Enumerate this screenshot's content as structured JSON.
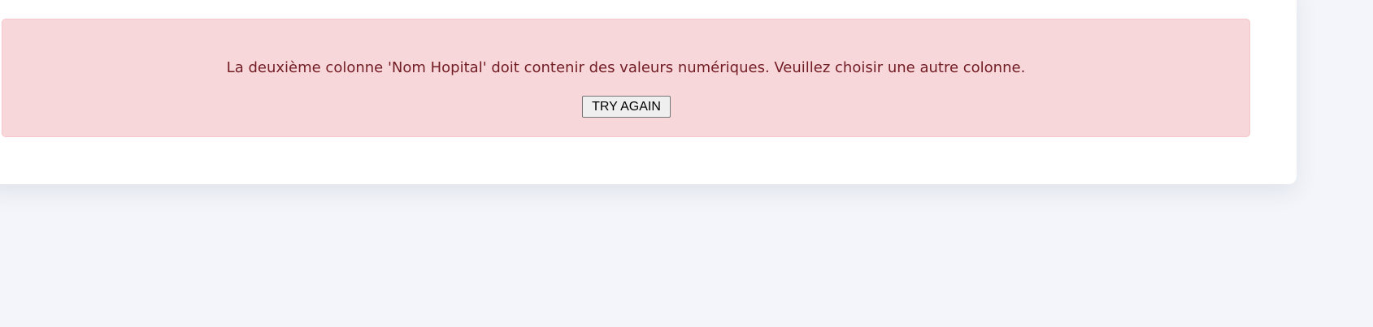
{
  "error_alert": {
    "message": "La deuxième colonne 'Nom Hopital' doit contenir des valeurs numériques. Veuillez choisir une autre colonne.",
    "try_again_label": "TRY AGAIN"
  },
  "colors": {
    "page_background": "#f3f5fa",
    "card_background": "#ffffff",
    "alert_background": "#f8d7da",
    "alert_border": "#f5c6cb",
    "alert_text": "#721c24",
    "button_background": "#efefef"
  }
}
